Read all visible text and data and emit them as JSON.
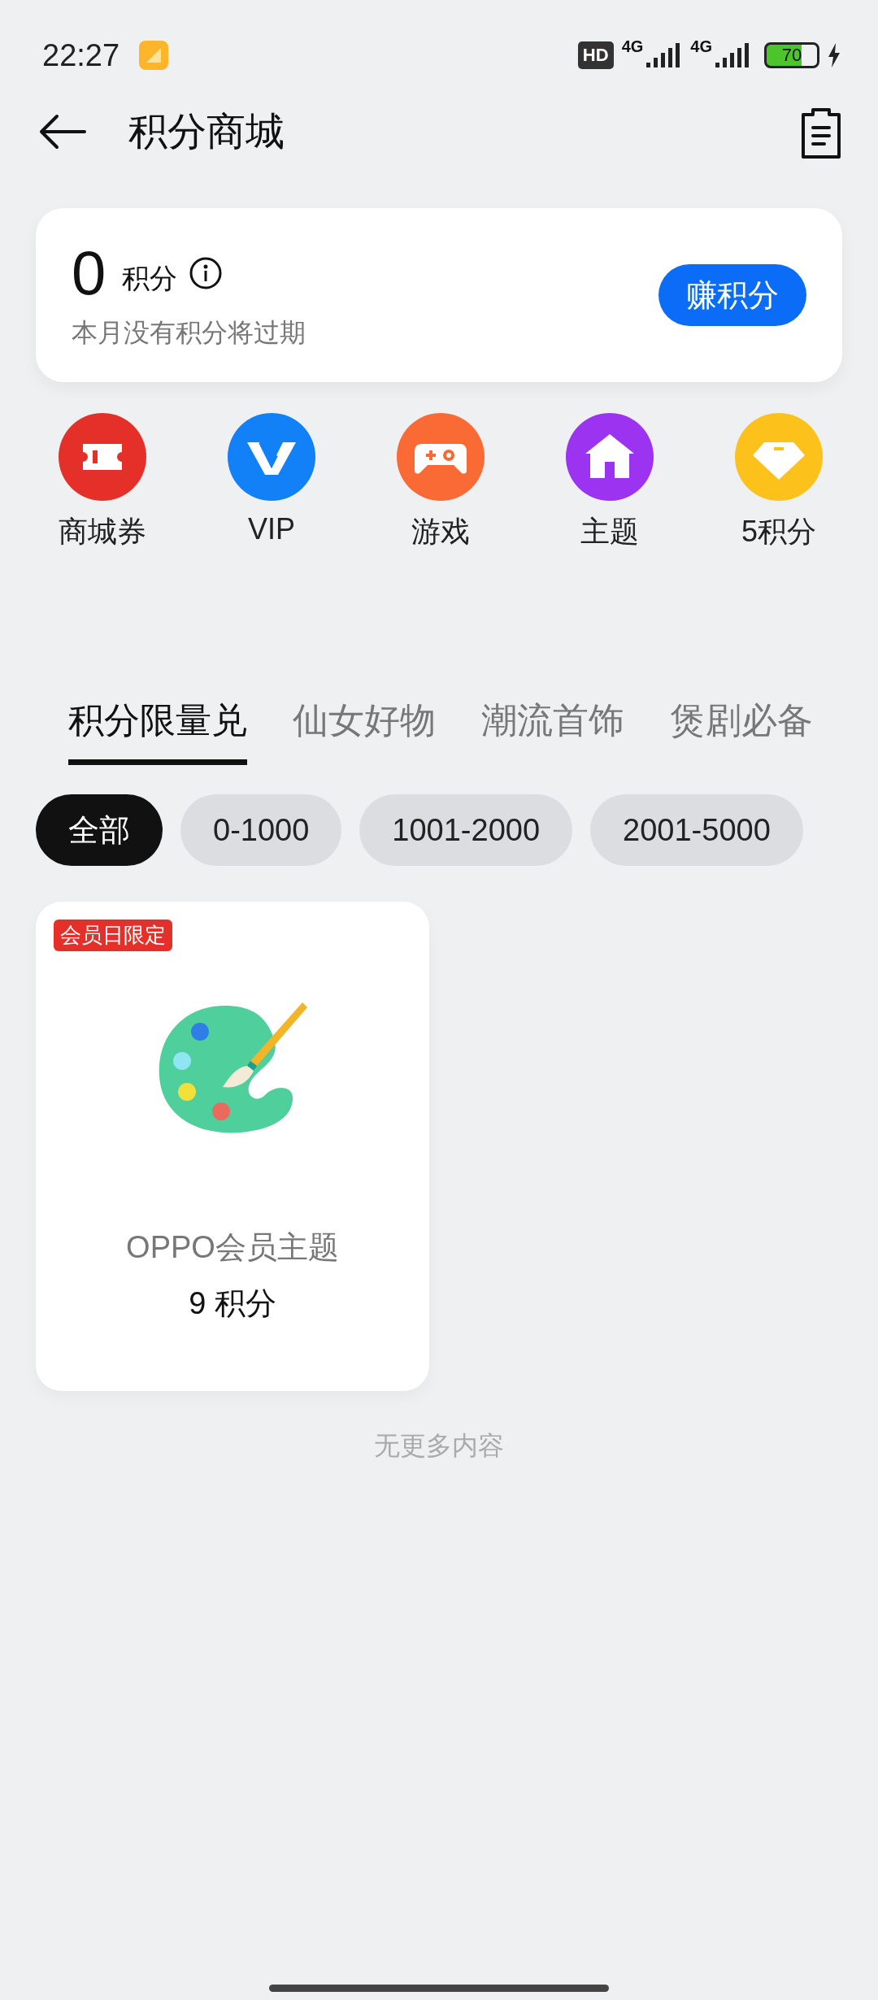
{
  "status_bar": {
    "time": "22:27",
    "hd": "HD",
    "sim1": "4G",
    "sim2": "4G",
    "battery": "70"
  },
  "header": {
    "title": "积分商城"
  },
  "points": {
    "value": "0",
    "unit": "积分",
    "note": "本月没有积分将过期",
    "button": "赚积分"
  },
  "shortcuts": [
    {
      "label": "商城券",
      "color": "#e5302a",
      "kind": "ticket"
    },
    {
      "label": "VIP",
      "color": "#1280f7",
      "kind": "vip"
    },
    {
      "label": "游戏",
      "color": "#fa6a34",
      "kind": "game"
    },
    {
      "label": "主题",
      "color": "#9b33f0",
      "kind": "home"
    },
    {
      "label": "5积分",
      "color": "#fcc11b",
      "kind": "diamond"
    }
  ],
  "tabs": [
    {
      "label": "积分限量兑",
      "selected": true
    },
    {
      "label": "仙女好物",
      "selected": false
    },
    {
      "label": "潮流首饰",
      "selected": false
    },
    {
      "label": "煲剧必备",
      "selected": false
    }
  ],
  "filters": [
    {
      "label": "全部",
      "selected": true
    },
    {
      "label": "0-1000",
      "selected": false
    },
    {
      "label": "1001-2000",
      "selected": false
    },
    {
      "label": "2001-5000",
      "selected": false
    }
  ],
  "products": [
    {
      "badge": "会员日限定",
      "name": "OPPO会员主题",
      "price": "9 积分"
    }
  ],
  "footer": "无更多内容"
}
